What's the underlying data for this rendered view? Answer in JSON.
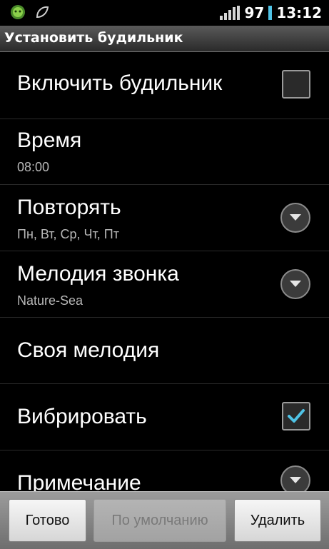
{
  "status_bar": {
    "left_icons": [
      "android-robot-icon",
      "leaf-notification-icon"
    ],
    "signal_icon": "signal-bars-icon",
    "battery_level": "97",
    "battery_icon": "battery-bar-icon",
    "time": "13:12"
  },
  "title_bar": {
    "title": "Установить будильник"
  },
  "settings": {
    "enable_alarm": {
      "label": "Включить будильник",
      "checked": false
    },
    "time": {
      "label": "Время",
      "value": "08:00"
    },
    "repeat": {
      "label": "Повторять",
      "value": "Пн, Вт, Ср, Чт, Пт"
    },
    "ringtone": {
      "label": "Мелодия звонка",
      "value": "Nature-Sea"
    },
    "custom_ringtone": {
      "label": "Своя мелодия"
    },
    "vibrate": {
      "label": "Вибрировать",
      "checked": true
    },
    "note": {
      "label": "Примечание"
    }
  },
  "buttons": {
    "done": "Готово",
    "default": "По умолчанию",
    "delete": "Удалить"
  },
  "colors": {
    "accent": "#4fc3e6",
    "background": "#000000",
    "subtext": "#b8b8b8"
  }
}
